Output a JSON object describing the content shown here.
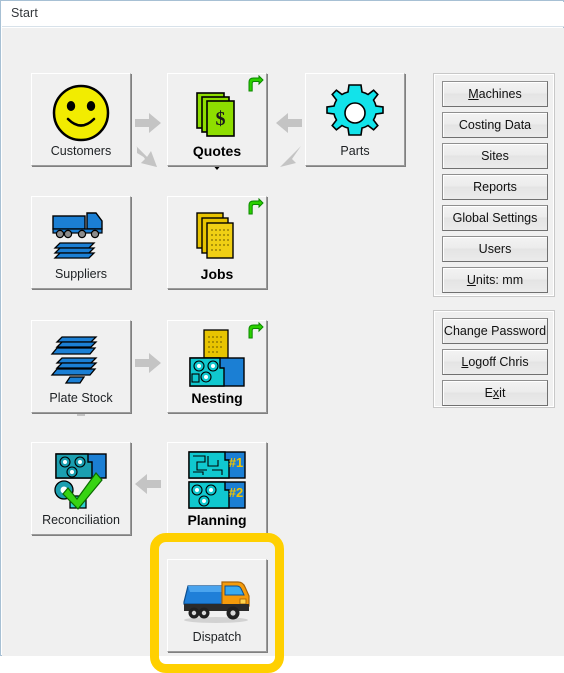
{
  "window": {
    "title": "Start"
  },
  "flow": {
    "tiles": [
      {
        "id": "customers",
        "label": "Customers",
        "icon": "smiley-face-icon",
        "bold": false,
        "badge": null
      },
      {
        "id": "quotes",
        "label": "Quotes",
        "icon": "dollar-documents-icon",
        "bold": true,
        "badge": "green-return-arrow-icon"
      },
      {
        "id": "parts",
        "label": "Parts",
        "icon": "cyan-gear-icon",
        "bold": false,
        "badge": null
      },
      {
        "id": "suppliers",
        "label": "Suppliers",
        "icon": "truck-and-plates-icon",
        "bold": false,
        "badge": null
      },
      {
        "id": "jobs",
        "label": "Jobs",
        "icon": "yellow-documents-icon",
        "bold": true,
        "badge": "green-return-arrow-icon"
      },
      {
        "id": "plate-stock",
        "label": "Plate Stock",
        "icon": "stacked-plates-icon",
        "bold": false,
        "badge": null
      },
      {
        "id": "nesting",
        "label": "Nesting",
        "icon": "nesting-layout-icon",
        "bold": true,
        "badge": "green-return-arrow-icon"
      },
      {
        "id": "reconciliation",
        "label": "Reconciliation",
        "icon": "nest-checkmark-icon",
        "bold": false,
        "badge": null
      },
      {
        "id": "planning",
        "label": "Planning",
        "icon": "planning-nests-icon",
        "bold": true,
        "badge": null
      },
      {
        "id": "dispatch",
        "label": "Dispatch",
        "icon": "dispatch-truck-icon",
        "bold": false,
        "badge": null
      }
    ],
    "planning_nest_labels": [
      "#1",
      "#2"
    ],
    "arrows": [
      {
        "id": "customers-to-quotes",
        "direction": "right",
        "tone": "light"
      },
      {
        "id": "parts-to-quotes",
        "direction": "left",
        "tone": "light"
      },
      {
        "id": "customers-to-suppliers",
        "direction": "down-right",
        "tone": "light"
      },
      {
        "id": "parts-to-jobs",
        "direction": "down-left",
        "tone": "light"
      },
      {
        "id": "quotes-to-jobs",
        "direction": "down",
        "tone": "dark"
      },
      {
        "id": "suppliers-to-platestock",
        "direction": "down",
        "tone": "light"
      },
      {
        "id": "jobs-to-nesting",
        "direction": "down",
        "tone": "dark"
      },
      {
        "id": "platestock-to-nesting",
        "direction": "right",
        "tone": "light"
      },
      {
        "id": "reconciliation-up",
        "direction": "up",
        "tone": "light"
      },
      {
        "id": "nesting-to-planning",
        "direction": "down",
        "tone": "dark"
      },
      {
        "id": "planning-to-recon",
        "direction": "left",
        "tone": "light"
      },
      {
        "id": "planning-to-dispatch",
        "direction": "down",
        "tone": "light"
      }
    ],
    "highlight": {
      "target": "dispatch",
      "color": "#ffd000"
    }
  },
  "sidebar": {
    "group_primary": [
      {
        "id": "machines",
        "label": "Machines",
        "accel": "M"
      },
      {
        "id": "costing-data",
        "label": "Costing Data",
        "accel": ""
      },
      {
        "id": "sites",
        "label": "Sites",
        "accel": ""
      },
      {
        "id": "reports",
        "label": "Reports",
        "accel": ""
      },
      {
        "id": "global-settings",
        "label": "Global Settings",
        "accel": ""
      },
      {
        "id": "users",
        "label": "Users",
        "accel": ""
      },
      {
        "id": "units",
        "label": "Units: mm",
        "accel": "U"
      }
    ],
    "group_session": [
      {
        "id": "change-password",
        "label": "Change Password",
        "accel": ""
      },
      {
        "id": "logoff",
        "label": "Logoff Chris",
        "accel": "L"
      },
      {
        "id": "exit",
        "label": "Exit",
        "accel": "x"
      }
    ]
  },
  "colors": {
    "highlight": "#ffd000",
    "window_border": "#a7c0d4",
    "client_bg": "#f0f0f0",
    "arrow_light": "#c4c4c4",
    "arrow_dark": "#000000",
    "badge_green": "#2bd000"
  }
}
